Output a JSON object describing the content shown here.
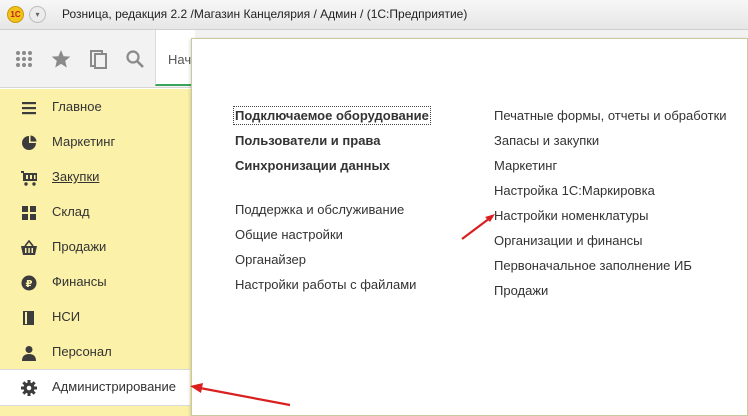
{
  "titlebar": {
    "logo": "1С",
    "title": "Розница, редакция 2.2 /Магазин Канцелярия / Админ /  (1С:Предприятие)"
  },
  "toolbar": {
    "icons": [
      "apps-grid-icon",
      "star-icon",
      "history-icon",
      "search-icon"
    ],
    "home_tab_label": "Нач"
  },
  "sidebar": {
    "items": [
      {
        "label": "Главное",
        "icon": "menu-lines-icon"
      },
      {
        "label": "Маркетинг",
        "icon": "pie-chart-icon"
      },
      {
        "label": "Закупки",
        "icon": "cart-icon"
      },
      {
        "label": "Склад",
        "icon": "warehouse-grid-icon"
      },
      {
        "label": "Продажи",
        "icon": "basket-icon"
      },
      {
        "label": "Финансы",
        "icon": "ruble-coin-icon"
      },
      {
        "label": "НСИ",
        "icon": "book-icon"
      },
      {
        "label": "Персонал",
        "icon": "person-icon"
      },
      {
        "label": "Администрирование",
        "icon": "gear-icon"
      }
    ],
    "active_index": 8,
    "colors": {
      "background": "#fbf1a9",
      "active": "#ffffff"
    }
  },
  "panel": {
    "col1_group1": [
      "Подключаемое оборудование",
      "Пользователи и права",
      "Синхронизации данных"
    ],
    "col1_group2": [
      "Поддержка и обслуживание",
      "Общие настройки",
      "Органайзер",
      "Настройки работы с файлами"
    ],
    "col2": [
      "Печатные формы, отчеты и обработки",
      "Запасы и закупки",
      "Маркетинг",
      "Настройка 1С:Маркировка",
      "Настройки номенклатуры",
      "Организации и финансы",
      "Первоначальное заполнение ИБ",
      "Продажи"
    ]
  },
  "annotation_color": "#d9201e"
}
